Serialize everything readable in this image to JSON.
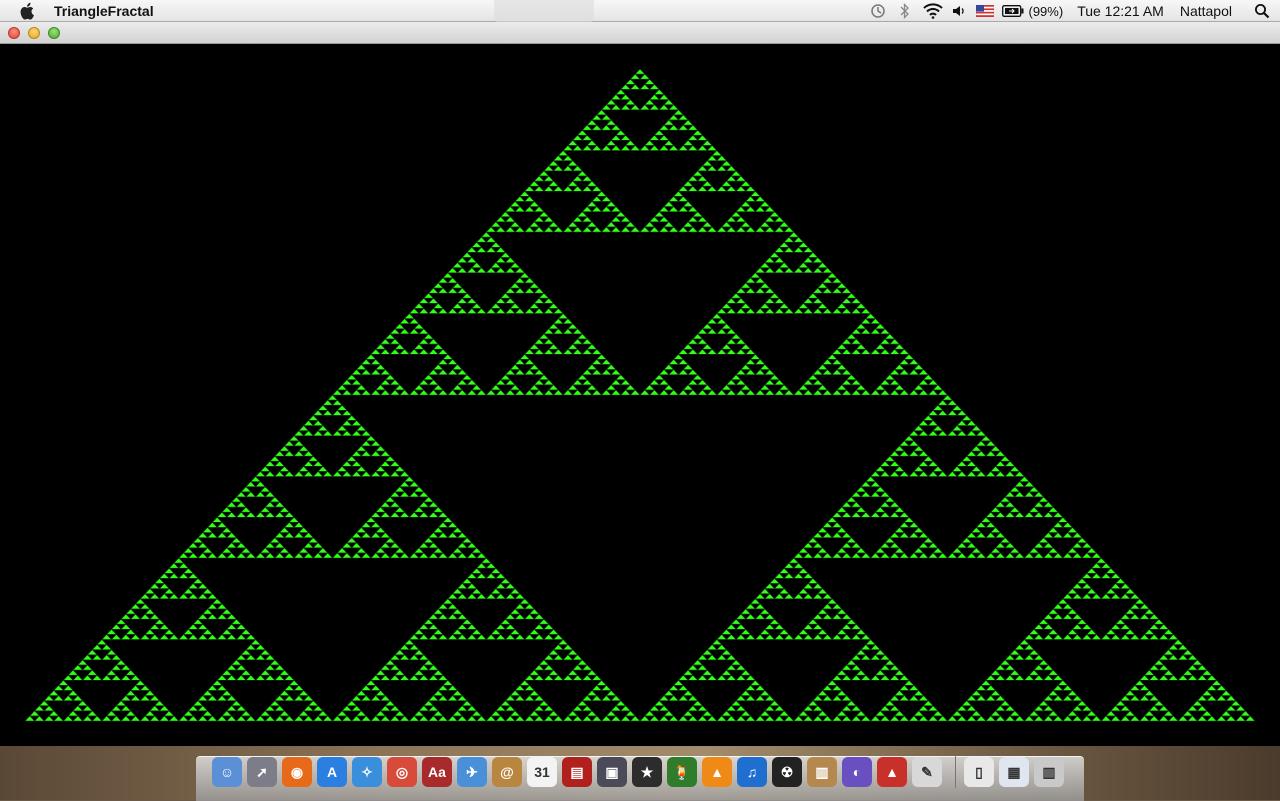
{
  "menubar": {
    "app_name": "TriangleFractal",
    "battery_percent": "(99%)",
    "clock": "Tue 12:21 AM",
    "user": "Nattapol"
  },
  "window": {
    "title": ""
  },
  "fractal": {
    "color": "#33ff1a",
    "background": "#000000",
    "depth": 7
  },
  "dock": {
    "icons": [
      {
        "name": "finder-icon",
        "color": "#5b8fd6",
        "glyph": "☺"
      },
      {
        "name": "launchpad-icon",
        "color": "#7d7d8a",
        "glyph": "➚"
      },
      {
        "name": "firefox-icon",
        "color": "#e66a1a",
        "glyph": "◉"
      },
      {
        "name": "app-store-icon",
        "color": "#2a7fe0",
        "glyph": "A"
      },
      {
        "name": "safari-icon",
        "color": "#3a8fdc",
        "glyph": "✧"
      },
      {
        "name": "chrome-icon",
        "color": "#d84b3a",
        "glyph": "◎"
      },
      {
        "name": "dictionary-icon",
        "color": "#a82a2a",
        "glyph": "Aa"
      },
      {
        "name": "mail-icon",
        "color": "#4a90d8",
        "glyph": "✈"
      },
      {
        "name": "address-book-icon",
        "color": "#b8863f",
        "glyph": "@"
      },
      {
        "name": "calendar-icon",
        "color": "#f3f3f3",
        "glyph": "31"
      },
      {
        "name": "photo-booth-icon",
        "color": "#b0201c",
        "glyph": "▤"
      },
      {
        "name": "iphoto-icon",
        "color": "#4a4a58",
        "glyph": "▣"
      },
      {
        "name": "imovie-icon",
        "color": "#2c2c2c",
        "glyph": "★"
      },
      {
        "name": "cocktail-icon",
        "color": "#2f7d2a",
        "glyph": "🍹"
      },
      {
        "name": "vlc-icon",
        "color": "#f08a16",
        "glyph": "▲"
      },
      {
        "name": "itunes-icon",
        "color": "#1e6fd0",
        "glyph": "♫"
      },
      {
        "name": "nuclear-app-icon",
        "color": "#222222",
        "glyph": "☢"
      },
      {
        "name": "archive-icon",
        "color": "#b5894e",
        "glyph": "▥"
      },
      {
        "name": "eclipse-icon",
        "color": "#6a4fc0",
        "glyph": "◐"
      },
      {
        "name": "santa-app-icon",
        "color": "#c8302a",
        "glyph": "▲"
      },
      {
        "name": "preview-icon",
        "color": "#d8d8d8",
        "glyph": "✎"
      }
    ],
    "right_icons": [
      {
        "name": "documents-stack-icon",
        "color": "#e8e8e8",
        "glyph": "▯"
      },
      {
        "name": "downloads-stack-icon",
        "color": "#dfe6ef",
        "glyph": "▦"
      },
      {
        "name": "trash-icon",
        "color": "#c9c9c9",
        "glyph": "▥"
      }
    ]
  }
}
